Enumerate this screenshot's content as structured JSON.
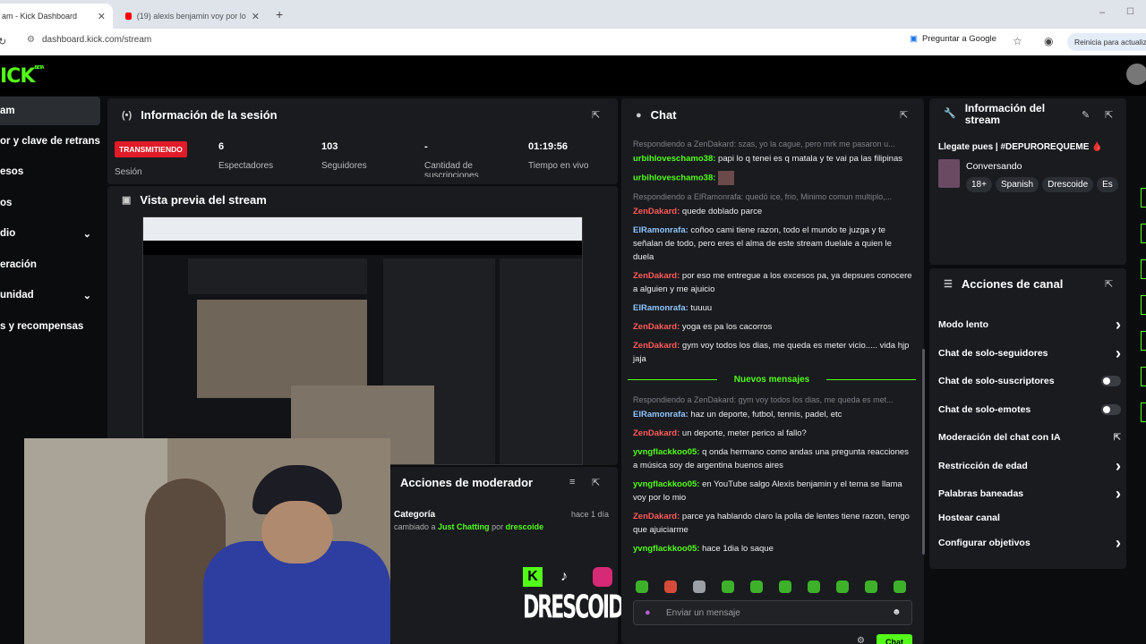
{
  "browser": {
    "tab1": "am - Kick Dashboard",
    "tab2": "(19) alexis benjamin voy por lo",
    "url": "dashboard.kick.com/stream",
    "google_btn": "Preguntar a Google",
    "restart_btn": "Reinicia para actualiz"
  },
  "brand": {
    "logo": "ICK",
    "beta": "BETA",
    "accent": "#53fc18"
  },
  "sidebar": {
    "items": [
      {
        "label": "am",
        "chevron": false
      },
      {
        "label": "or y clave de retransm",
        "chevron": false
      },
      {
        "label": "esos",
        "chevron": false
      },
      {
        "label": "os",
        "chevron": false
      },
      {
        "label": "dio",
        "chevron": true
      },
      {
        "label": "eración",
        "chevron": false
      },
      {
        "label": "unidad",
        "chevron": true
      },
      {
        "label": "s y recompensas",
        "chevron": false
      }
    ]
  },
  "session": {
    "title": "Información de la sesión",
    "live_badge": "TRANSMITIENDO",
    "session_label": "Sesión",
    "stats": [
      {
        "value": "6",
        "label": "Espectadores"
      },
      {
        "value": "103",
        "label": "Seguidores"
      },
      {
        "value": "-",
        "label": "Cantidad de suscripciones"
      },
      {
        "value": "01:19:56",
        "label": "Tiempo en vivo"
      }
    ]
  },
  "preview": {
    "title": "Vista previa del stream"
  },
  "moderator": {
    "title": "Acciones de moderador",
    "item_title": "Categoría",
    "item_time": "hace 1 día",
    "item_prefix": "cambiado a",
    "item_category": "Just Chatting",
    "item_by": "por",
    "item_user": "drescoide"
  },
  "overlay": {
    "brand_text": "DRESCOIDE"
  },
  "chat": {
    "title": "Chat",
    "messages": [
      {
        "reply": "Respondiendo a ZenDakard: szas, yo la cague, pero mrk me pasaron u...",
        "user": "urbihloveschamo38",
        "color": "green",
        "text": "papi lo q tenei es q matala y te vai pa las filipinas"
      },
      {
        "reply": "",
        "user": "urbihloveschamo38",
        "color": "green",
        "text": ""
      },
      {
        "reply": "Respondiendo a ElRamonrafa: quedó ice, frio, Minimo comun multiplo,...",
        "user": "ZenDakard",
        "color": "red",
        "text": "quede doblado parce"
      },
      {
        "reply": "",
        "user": "ElRamonrafa",
        "color": "blue",
        "text": "coñoo cami tiene razon, todo el mundo te juzga y te señalan de todo, pero eres el alma de este stream duelale a quien le duela"
      },
      {
        "reply": "",
        "user": "ZenDakard",
        "color": "red",
        "text": "por eso me entregue a los excesos pa, ya depsues conocere a alguien y me ajuicio"
      },
      {
        "reply": "",
        "user": "ElRamonrafa",
        "color": "blue",
        "text": "tuuuu"
      },
      {
        "reply": "",
        "user": "ZenDakard",
        "color": "red",
        "text": "yoga es pa los cacorros"
      },
      {
        "reply": "",
        "user": "ZenDakard",
        "color": "red",
        "text": "gym voy todos los dias, me queda es meter vicio..... vida hjp jaja"
      }
    ],
    "new_messages_label": "Nuevos mensajes",
    "new_messages": [
      {
        "reply": "Respondiendo a ZenDakard: gym voy todos los dias, me queda es met...",
        "user": "ElRamonrafa",
        "color": "blue",
        "text": "haz un deporte, futbol, tennis, padel, etc"
      },
      {
        "reply": "",
        "user": "ZenDakard",
        "color": "red",
        "text": "un deporte, meter perico al fallo?"
      },
      {
        "reply": "",
        "user": "yvngflackkoo05",
        "color": "green",
        "text": "q onda hermano como andas una pregunta reacciones a música soy de argentina buenos aires"
      },
      {
        "reply": "",
        "user": "yvngflackkoo05",
        "color": "green",
        "text": "en YouTube salgo Alexis benjamin y el tema se llama voy por lo mio"
      },
      {
        "reply": "",
        "user": "ZenDakard",
        "color": "red",
        "text": "parce ya hablando claro la polla de lentes tiene razon, tengo que ajuiciarme"
      },
      {
        "reply": "",
        "user": "yvngflackkoo05",
        "color": "green",
        "text": "hace 1dia lo saque"
      }
    ],
    "input_placeholder": "Enviar un mensaje",
    "send_label": "Chat"
  },
  "stream_info": {
    "title": "Información del stream",
    "stream_title": "Llegate pues | #DEPUROREQUEME 🩸",
    "category": "Conversando",
    "tags": [
      "18+",
      "Spanish",
      "Drescoide",
      "Es"
    ]
  },
  "channel_actions": {
    "title": "Acciones de canal",
    "items": [
      {
        "label": "Modo lento",
        "control": "chevron"
      },
      {
        "label": "Chat de solo-seguidores",
        "control": "chevron"
      },
      {
        "label": "Chat de solo-suscriptores",
        "control": "toggle"
      },
      {
        "label": "Chat de solo-emotes",
        "control": "toggle"
      },
      {
        "label": "Moderación del chat con IA",
        "control": "external"
      },
      {
        "label": "Restricción de edad",
        "control": "chevron"
      },
      {
        "label": "Palabras baneadas",
        "control": "chevron"
      },
      {
        "label": "Hostear canal",
        "control": "none"
      },
      {
        "label": "Configurar objetivos",
        "control": "chevron"
      }
    ]
  }
}
